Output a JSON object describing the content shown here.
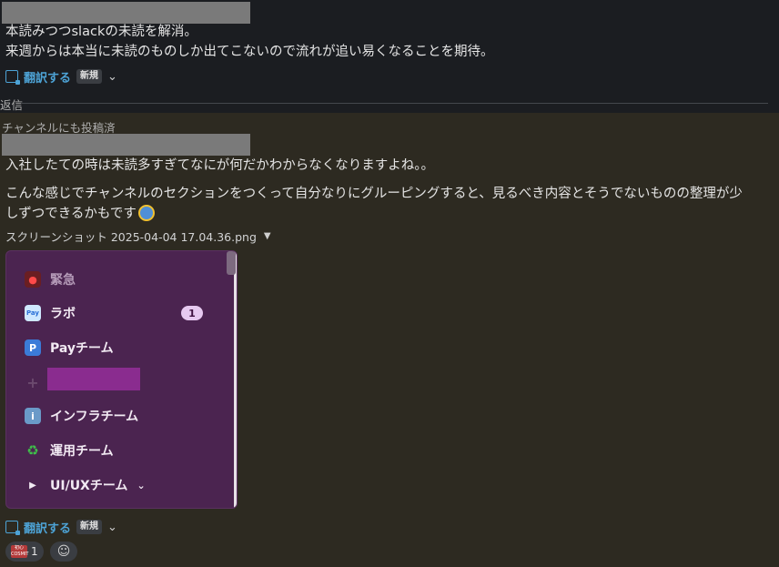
{
  "first_message": {
    "line1": "本読みつつslackの未読を解消。",
    "line2": "来週からは本当に未読のものしか出てこないので流れが追い易くなることを期待。",
    "translate_label": "翻訳する",
    "new_badge": "新規"
  },
  "thread_divider_label": "返信",
  "reply": {
    "also_posted": "チャンネルにも投稿済",
    "paragraph1": "入社したての時は未読多すぎてなにが何だかわからなくなりますよね。。",
    "paragraph2_line1": "こんな感じでチャンネルのセクションをつくって自分なりにグルーピングすると、見るべき内容とそうでないものの整理が少",
    "paragraph2_line2": "しずつできるかもです",
    "file_name": "スクリーンショット 2025-04-04 17.04.36.png",
    "translate_label": "翻訳する",
    "new_badge": "新規"
  },
  "screenshot_channels": [
    {
      "label": "緊急"
    },
    {
      "label": "ラボ",
      "count": "1"
    },
    {
      "label": "Payチーム"
    },
    {
      "label": ""
    },
    {
      "label": "インフラチーム"
    },
    {
      "label": "運用チーム"
    },
    {
      "label": "UI/UXチーム"
    }
  ],
  "reaction": {
    "count": "1",
    "emoji_text": "初心い\nCOSMIT"
  },
  "colors": {
    "top_bg": "#1b1d21",
    "thread_bg": "#2d2a21",
    "link_blue": "#4da3d6",
    "sidebar_purple": "#4b2450"
  }
}
